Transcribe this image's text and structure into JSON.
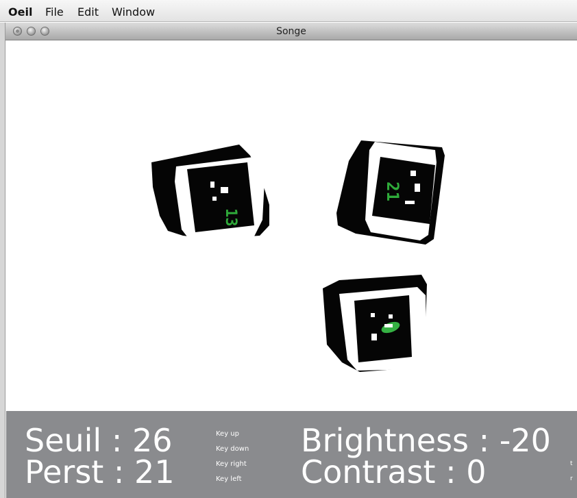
{
  "menubar": {
    "app_name": "Oeil",
    "items": [
      "File",
      "Edit",
      "Window"
    ]
  },
  "window": {
    "title": "Songe"
  },
  "markers": {
    "left_label": "13",
    "right_label": "21"
  },
  "status": {
    "seuil_label": "Seuil : 26",
    "perst_label": "Perst : 21",
    "brightness_label": "Brightness : -20",
    "contrast_label": "Contrast : 0",
    "key_up": "Key up",
    "key_down": "Key down",
    "key_right": "Key right",
    "key_left": "Key left",
    "clip_t": "t",
    "clip_r": "r"
  },
  "colors": {
    "panel_bg": "#8a8b8e",
    "marker_green": "#2faa3a"
  }
}
